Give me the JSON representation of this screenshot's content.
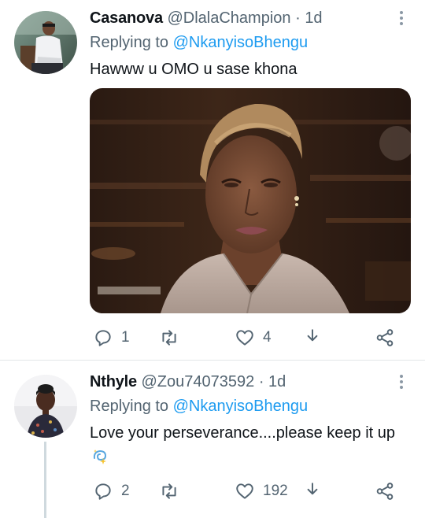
{
  "tweets": [
    {
      "display_name": "Casanova",
      "handle": "@DlalaChampion",
      "separator": "·",
      "time": "1d",
      "replying_label": "Replying to",
      "replying_to": "@NkanyisoBhengu",
      "text": "Hawww u OMO u sase khona",
      "has_media": true,
      "replies": "1",
      "retweets": "",
      "likes": "4"
    },
    {
      "display_name": "Nthyle",
      "handle": "@Zou74073592",
      "separator": "·",
      "time": "1d",
      "replying_label": "Replying to",
      "replying_to": "@NkanyisoBhengu",
      "text": "Love your perseverance....please keep it up",
      "emoji_icon": "dizzy-sparkle-icon",
      "has_media": false,
      "replies": "2",
      "retweets": "",
      "likes": "192"
    }
  ],
  "colors": {
    "text": "#0f1419",
    "secondary": "#536471",
    "link": "#1d9bf0",
    "divider": "#e3e6e8",
    "thread_line": "#cfd9de"
  },
  "icons": [
    "reply-icon",
    "retweet-icon",
    "like-icon",
    "share-icon",
    "more-share-icon",
    "kebab-menu-icon"
  ]
}
